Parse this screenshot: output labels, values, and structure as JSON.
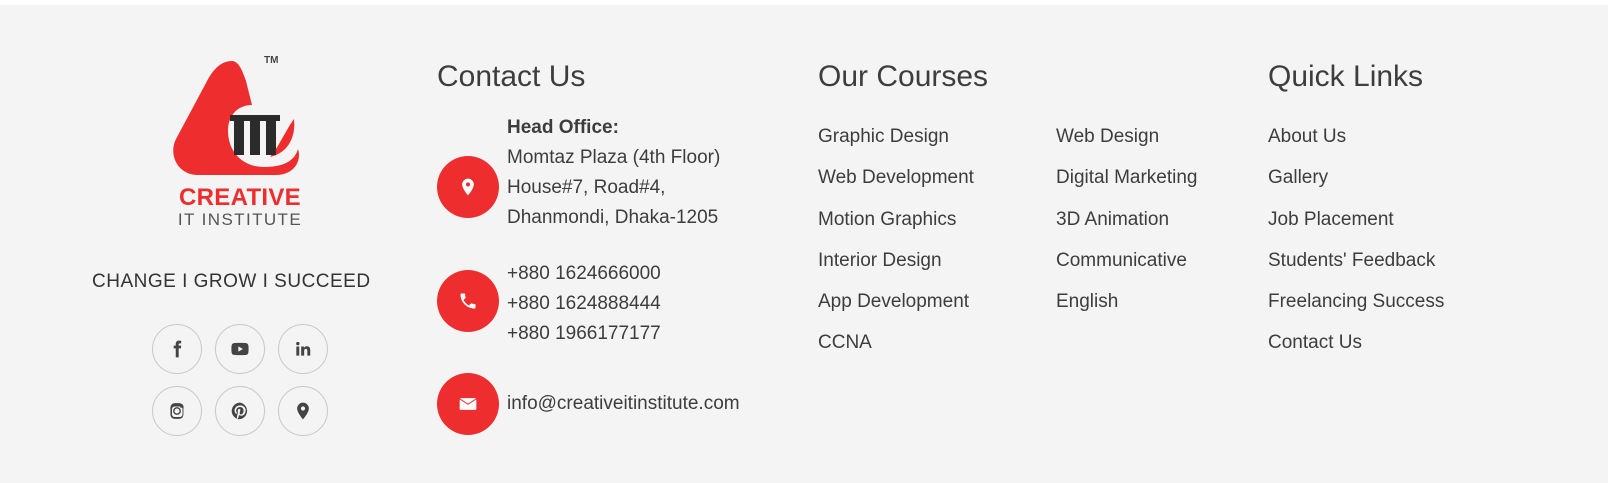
{
  "brand": {
    "name": "CREATIVE",
    "subname": "IT INSTITUTE",
    "trademark": "TM",
    "tagline": "CHANGE I GROW I SUCCEED"
  },
  "social": [
    {
      "name": "facebook",
      "icon": "facebook-icon"
    },
    {
      "name": "youtube",
      "icon": "youtube-icon"
    },
    {
      "name": "linkedin",
      "icon": "linkedin-icon"
    },
    {
      "name": "instagram",
      "icon": "instagram-icon"
    },
    {
      "name": "pinterest",
      "icon": "pinterest-icon"
    },
    {
      "name": "location",
      "icon": "map-pin-icon"
    }
  ],
  "contact": {
    "title": "Contact Us",
    "office_label": "Head Office:",
    "address": [
      "Momtaz Plaza (4th Floor)",
      "House#7, Road#4,",
      "Dhanmondi, Dhaka-1205"
    ],
    "phones": [
      "+880 1624666000",
      "+880 1624888444",
      "+880 1966177177"
    ],
    "email": "info@creativeitinstitute.com"
  },
  "courses": {
    "title": "Our Courses",
    "col1": [
      "Graphic Design",
      "Web Development",
      "Motion Graphics",
      "Interior Design",
      "App Development",
      "CCNA"
    ],
    "col2": [
      "Web Design",
      "Digital Marketing",
      "3D Animation",
      "Communicative",
      "English"
    ]
  },
  "quick_links": {
    "title": "Quick Links",
    "items": [
      "About Us",
      "Gallery",
      "Job Placement",
      "Students' Feedback",
      "Freelancing Success",
      "Contact Us"
    ]
  },
  "colors": {
    "accent": "#ee2e2e",
    "background": "#f4f4f4",
    "text": "#3d3d3d"
  }
}
